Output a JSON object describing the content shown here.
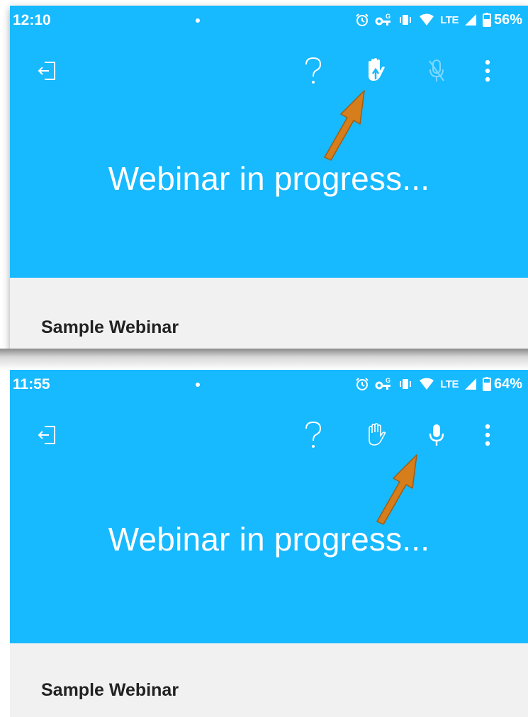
{
  "screens": [
    {
      "status_time": "12:10",
      "status_network": "LTE",
      "status_battery": "56%",
      "heading": "Webinar in progress...",
      "webinar_name": "Sample Webinar",
      "toolbar_icons": [
        "exit-icon",
        "help-icon",
        "raised-hand-icon",
        "mic-off-icon",
        "more-icon"
      ],
      "hand_state": "raised",
      "mic_state": "disabled"
    },
    {
      "status_time": "11:55",
      "status_network": "LTE",
      "status_battery": "64%",
      "heading": "Webinar in progress...",
      "webinar_name": "Sample Webinar",
      "toolbar_icons": [
        "exit-icon",
        "help-icon",
        "hand-icon",
        "mic-icon",
        "more-icon"
      ],
      "hand_state": "lowered",
      "mic_state": "enabled"
    }
  ],
  "colors": {
    "app_bar": "#17b9ff",
    "content_bg": "#f1f1f1",
    "annotation_arrow": "#d67d1c"
  }
}
